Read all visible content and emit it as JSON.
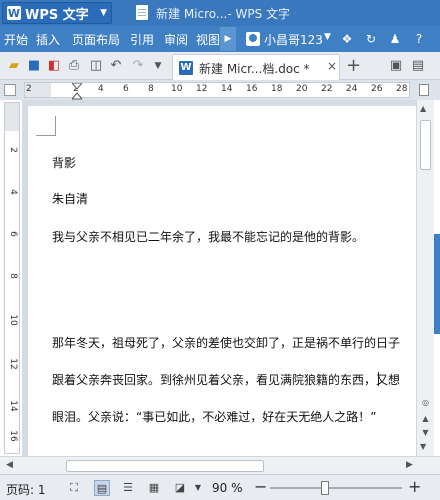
{
  "app": {
    "name": "WPS 文字",
    "logo_letter": "W",
    "window_title": "新建 Micro...- WPS 文字"
  },
  "menu": {
    "items": [
      "开始",
      "插入",
      "页面布局",
      "引用",
      "审阅",
      "视图"
    ],
    "user_name": "小昌哥123"
  },
  "tab": {
    "icon_letter": "W",
    "label": "新建 Micr...档.doc *",
    "close": "×",
    "new_tab": "+"
  },
  "ruler": {
    "numbers": [
      "2",
      "2",
      "4",
      "6",
      "8",
      "10",
      "12",
      "14",
      "16",
      "18",
      "20",
      "22",
      "24",
      "26",
      "28"
    ]
  },
  "vruler": {
    "numbers": [
      "2",
      "4",
      "6",
      "8",
      "10",
      "12",
      "14",
      "16"
    ]
  },
  "document": {
    "lines": [
      "背影",
      "朱自清",
      "我与父亲不相见已二年余了，我最不能忘记的是他的背影。",
      "那年冬天，祖母死了，父亲的差使也交卸了，正是祸不单行的日子",
      "跟着父亲奔丧回家。到徐州见着父亲，看见满院狼籍的东西，又想",
      "眼泪。父亲说：“事已如此，不必难过，好在天无绝人之路！”"
    ]
  },
  "status": {
    "page": "页码: 1",
    "zoom": "90 %",
    "zoom_fraction": 0.42
  },
  "colors": {
    "titlebar": "#3a78bd",
    "menubar": "#3f7fc4",
    "toolbar": "#e8ecf1"
  }
}
